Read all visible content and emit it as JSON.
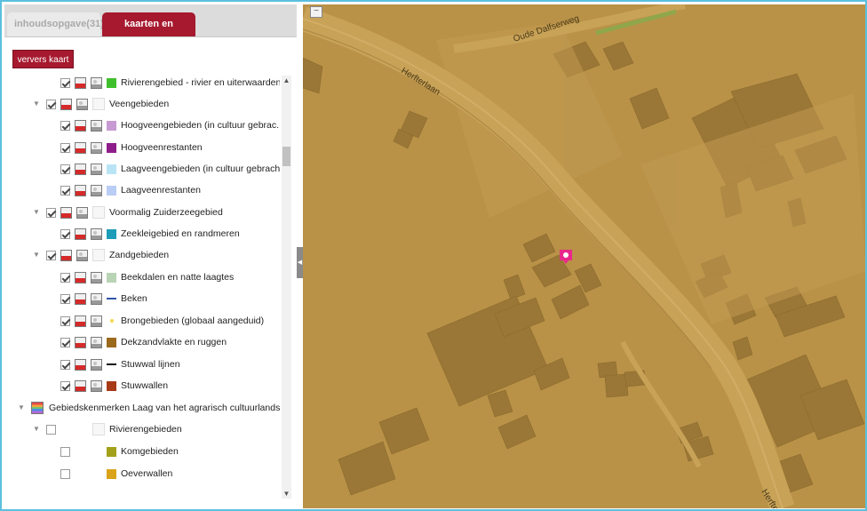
{
  "tabs": [
    {
      "label": "inhoudsopgave(31)",
      "active": false
    },
    {
      "label": "kaarten en legenda",
      "active": true
    }
  ],
  "refresh_button": "ververs kaart",
  "tree": [
    {
      "label": "Rivierengebied - rivier en uiterwaarden",
      "level": 2,
      "swatch": "#3fbf2b",
      "kind": "fill"
    },
    {
      "label": "Veengebieden",
      "level": 1,
      "kind": "group"
    },
    {
      "label": "Hoogveengebieden (in cultuur gebrac...",
      "level": 2,
      "swatch": "#c79ad3",
      "kind": "fill"
    },
    {
      "label": "Hoogveenrestanten",
      "level": 2,
      "swatch": "#8e1d8a",
      "kind": "fill"
    },
    {
      "label": "Laagveengebieden (in cultuur gebracht)",
      "level": 2,
      "swatch": "#b9e4f5",
      "kind": "fill"
    },
    {
      "label": "Laagveenrestanten",
      "level": 2,
      "swatch": "#b9cdf5",
      "kind": "fill"
    },
    {
      "label": "Voormalig Zuiderzeegebied",
      "level": 1,
      "kind": "group"
    },
    {
      "label": "Zeekleigebied en randmeren",
      "level": 2,
      "swatch": "#1d9db8",
      "kind": "fill"
    },
    {
      "label": "Zandgebieden",
      "level": 1,
      "kind": "group"
    },
    {
      "label": "Beekdalen en natte laagtes",
      "level": 2,
      "swatch": "#b9d4b4",
      "kind": "fill"
    },
    {
      "label": "Beken",
      "level": 2,
      "swatch": "#2f55a8",
      "kind": "line"
    },
    {
      "label": "Brongebieden (globaal aangeduid)",
      "level": 2,
      "swatch": "#f3d94a",
      "kind": "dot"
    },
    {
      "label": "Dekzandvlakte en ruggen",
      "level": 2,
      "swatch": "#9b6a1c",
      "kind": "fill"
    },
    {
      "label": "Stuwwal lijnen",
      "level": 2,
      "swatch": "#111111",
      "kind": "dash"
    },
    {
      "label": "Stuwwallen",
      "level": 2,
      "swatch": "#a83b17",
      "kind": "fill"
    },
    {
      "label": "Gebiedskenmerken Laag van het agrarisch cultuurlandsc...",
      "level": 0,
      "kind": "root"
    },
    {
      "label": "Rivierengebieden",
      "level": 1,
      "kind": "group-unchecked"
    },
    {
      "label": "Komgebieden",
      "level": 2,
      "swatch": "#a3a01a",
      "kind": "fill-unchecked"
    },
    {
      "label": "Oeverwallen",
      "level": 2,
      "swatch": "#d9a419",
      "kind": "fill-unchecked"
    }
  ],
  "map": {
    "street_labels": [
      "Oude Dalfserweg",
      "Herfterlaan",
      "Herfte"
    ],
    "zoom_out_label": "−",
    "marker_color": "#e8288a",
    "background": "#b99248"
  },
  "icons": {
    "scroll_up": "▲",
    "scroll_down": "▼",
    "collapse": "◀",
    "expand": "▼"
  }
}
